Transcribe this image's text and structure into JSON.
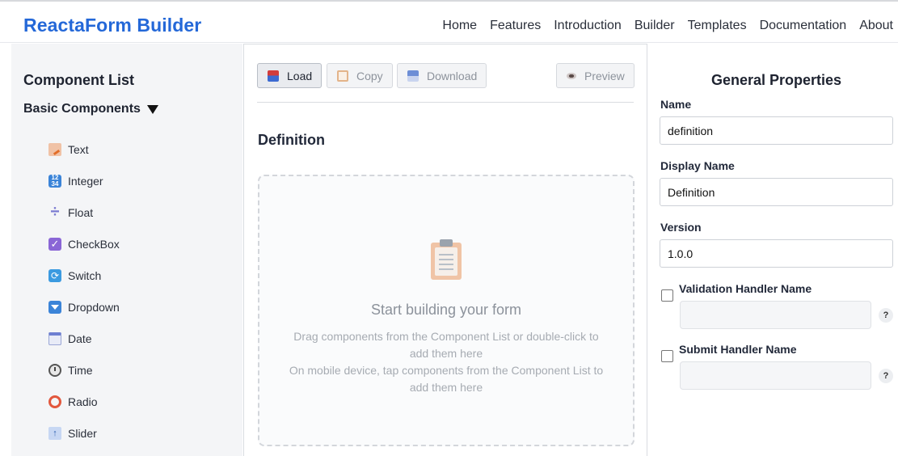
{
  "header": {
    "brand": "ReactaForm Builder",
    "nav": [
      "Home",
      "Features",
      "Introduction",
      "Builder",
      "Templates",
      "Documentation",
      "About"
    ]
  },
  "component_list": {
    "title": "Component List",
    "section": "Basic Components",
    "items": [
      {
        "label": "Text",
        "icon": "text-icon"
      },
      {
        "label": "Integer",
        "icon": "integer-icon"
      },
      {
        "label": "Float",
        "icon": "float-icon"
      },
      {
        "label": "CheckBox",
        "icon": "checkbox-icon"
      },
      {
        "label": "Switch",
        "icon": "switch-icon"
      },
      {
        "label": "Dropdown",
        "icon": "dropdown-icon"
      },
      {
        "label": "Date",
        "icon": "calendar-icon"
      },
      {
        "label": "Time",
        "icon": "clock-icon"
      },
      {
        "label": "Radio",
        "icon": "radio-icon"
      },
      {
        "label": "Slider",
        "icon": "slider-icon"
      }
    ]
  },
  "toolbar": {
    "load": "Load",
    "copy": "Copy",
    "download": "Download",
    "preview": "Preview"
  },
  "canvas": {
    "title": "Definition",
    "empty_title": "Start building your form",
    "empty_line1": "Drag components from the Component List or double-click to add them here",
    "empty_line2": "On mobile device, tap components from the Component List to add them here"
  },
  "properties": {
    "title": "General Properties",
    "name_label": "Name",
    "name_value": "definition",
    "display_name_label": "Display Name",
    "display_name_value": "Definition",
    "version_label": "Version",
    "version_value": "1.0.0",
    "validation_label": "Validation Handler Name",
    "submit_label": "Submit Handler Name",
    "help": "?"
  }
}
